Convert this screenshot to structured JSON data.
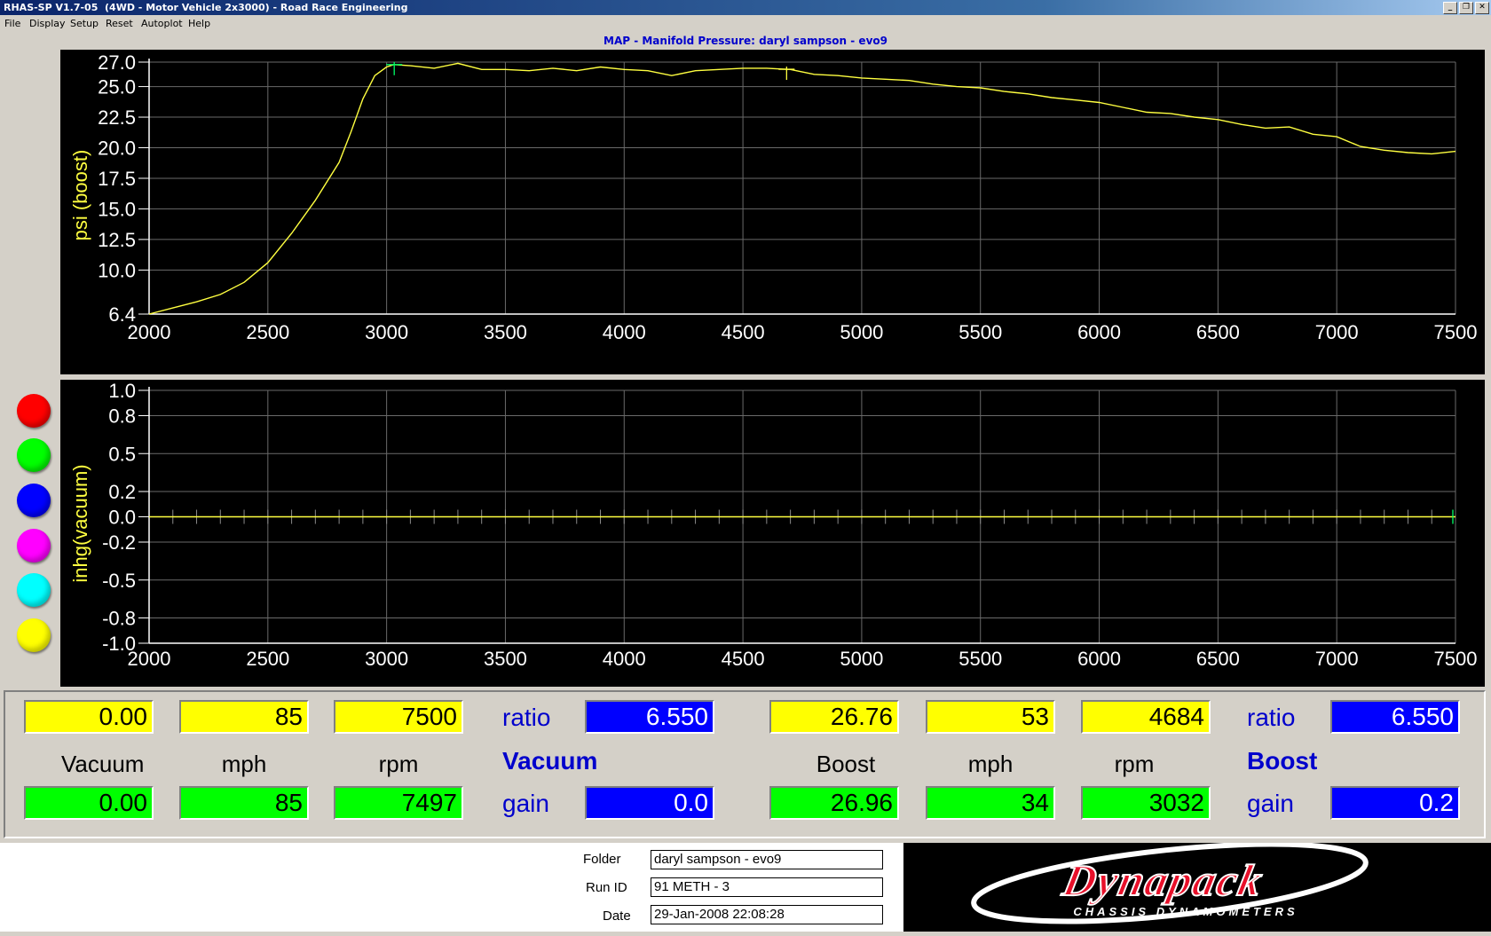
{
  "window": {
    "title": "RHAS-SP V1.7-05  (4WD - Motor Vehicle 2x3000) - Road Race Engineering",
    "buttons": [
      "_",
      "❐",
      "✕"
    ]
  },
  "menu": [
    "File",
    "Display",
    "Setup",
    "Reset",
    "Autoplot",
    "Help"
  ],
  "chart_title": "MAP - Manifold Pressure: daryl sampson - evo9",
  "chart_data": [
    {
      "type": "line",
      "ylabel": "psi (boost)",
      "xlim": [
        2000,
        7500
      ],
      "ylim": [
        6.4,
        27.0
      ],
      "yticks": [
        "27.0",
        "25.0",
        "22.5",
        "20.0",
        "17.5",
        "15.0",
        "12.5",
        "10.0",
        "6.4"
      ],
      "xticks": [
        "2000",
        "2500",
        "3000",
        "3500",
        "4000",
        "4500",
        "5000",
        "5500",
        "6000",
        "6500",
        "7000",
        "7500"
      ],
      "grid": true,
      "color": "#ffff40",
      "series": [
        {
          "x": [
            2000,
            2100,
            2200,
            2300,
            2400,
            2500,
            2600,
            2700,
            2800,
            2850,
            2900,
            2950,
            3000,
            3030,
            3100,
            3200,
            3300,
            3400,
            3500,
            3600,
            3700,
            3800,
            3900,
            4000,
            4100,
            4200,
            4300,
            4400,
            4500,
            4600,
            4700,
            4800,
            4900,
            5000,
            5100,
            5200,
            5300,
            5400,
            5500,
            5600,
            5700,
            5800,
            5900,
            6000,
            6100,
            6200,
            6300,
            6400,
            6500,
            6600,
            6700,
            6800,
            6900,
            7000,
            7100,
            7200,
            7300,
            7400,
            7500
          ],
          "y": [
            6.4,
            6.9,
            7.4,
            8.0,
            9.0,
            10.6,
            13.0,
            15.7,
            18.8,
            21.3,
            24.0,
            25.9,
            26.6,
            26.8,
            26.7,
            26.5,
            26.9,
            26.4,
            26.4,
            26.3,
            26.5,
            26.3,
            26.6,
            26.4,
            26.3,
            25.9,
            26.3,
            26.4,
            26.5,
            26.5,
            26.4,
            26.0,
            25.9,
            25.7,
            25.6,
            25.5,
            25.2,
            25.0,
            24.9,
            24.6,
            24.4,
            24.1,
            23.9,
            23.7,
            23.3,
            22.9,
            22.8,
            22.5,
            22.3,
            21.9,
            21.6,
            21.7,
            21.1,
            20.9,
            20.1,
            19.8,
            19.6,
            19.5,
            19.7
          ]
        }
      ],
      "cursors": [
        3032,
        4684
      ]
    },
    {
      "type": "line",
      "ylabel": "inhg(vacuum)",
      "xlim": [
        2000,
        7500
      ],
      "ylim": [
        -1.0,
        1.0
      ],
      "yticks": [
        "1.0",
        "0.8",
        "0.5",
        "0.2",
        "0.0",
        "-0.2",
        "-0.5",
        "-0.8",
        "-1.0"
      ],
      "xticks": [
        "2000",
        "2500",
        "3000",
        "3500",
        "4000",
        "4500",
        "5000",
        "5500",
        "6000",
        "6500",
        "7000",
        "7500"
      ],
      "grid": true,
      "color": "#ffff40",
      "series": [
        {
          "x": [
            2000,
            7500
          ],
          "y": [
            0.0,
            0.0
          ]
        }
      ]
    }
  ],
  "swatches": [
    "#ff0000",
    "#00ff00",
    "#0000ff",
    "#ff00ff",
    "#00ffff",
    "#ffff00"
  ],
  "vacuum": {
    "top": {
      "value": "0.00",
      "mph": "85",
      "rpm": "7500"
    },
    "bottom": {
      "value": "0.00",
      "mph": "85",
      "rpm": "7497"
    },
    "labels": {
      "value": "Vacuum",
      "mph": "mph",
      "rpm": "rpm"
    },
    "ratio_label": "ratio",
    "ratio": "6.550",
    "title": "Vacuum",
    "gain_label": "gain",
    "gain": "0.0"
  },
  "boost": {
    "top": {
      "value": "26.76",
      "mph": "53",
      "rpm": "4684"
    },
    "bottom": {
      "value": "26.96",
      "mph": "34",
      "rpm": "3032"
    },
    "labels": {
      "value": "Boost",
      "mph": "mph",
      "rpm": "rpm"
    },
    "ratio_label": "ratio",
    "ratio": "6.550",
    "title": "Boost",
    "gain_label": "gain",
    "gain": "0.2"
  },
  "info": {
    "folder_label": "Folder",
    "folder": "daryl sampson - evo9",
    "runid_label": "Run ID",
    "runid": "91 METH - 3",
    "date_label": "Date",
    "date": "29-Jan-2008  22:08:28"
  },
  "logo": {
    "brand": "Dynapack",
    "tagline": "CHASSIS DYNAMOMETERS"
  }
}
